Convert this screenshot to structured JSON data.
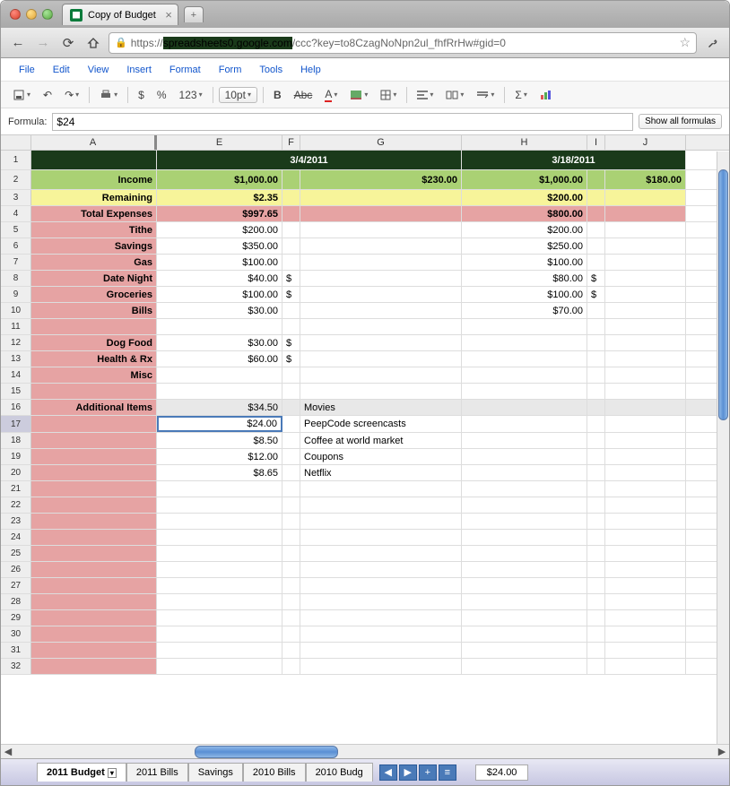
{
  "browser": {
    "tab_title": "Copy of Budget",
    "url_proto": "https",
    "url_host": "spreadsheets0.google.com",
    "url_rest": "/ccc?key=to8CzagNoNpn2ul_fhfRrHw#gid=0"
  },
  "menubar": [
    "File",
    "Edit",
    "View",
    "Insert",
    "Format",
    "Form",
    "Tools",
    "Help"
  ],
  "toolbar": {
    "currency": "$",
    "percent": "%",
    "more": "123",
    "font_size": "10pt"
  },
  "formula": {
    "label": "Formula:",
    "value": "$24",
    "show_all": "Show all formulas"
  },
  "columns": [
    "A",
    "E",
    "F",
    "G",
    "H",
    "I",
    "J"
  ],
  "header_row": {
    "date1": "3/4/2011",
    "date2": "3/18/2011"
  },
  "labels": {
    "income": "Income",
    "remaining": "Remaining",
    "total_expenses": "Total Expenses",
    "tithe": "Tithe",
    "savings": "Savings",
    "gas": "Gas",
    "date_night": "Date Night",
    "groceries": "Groceries",
    "bills": "Bills",
    "dog_food": "Dog Food",
    "health": "Health & Rx",
    "misc": "Misc",
    "additional": "Additional Items"
  },
  "period1": {
    "income1": "$1,000.00",
    "income2": "$230.00",
    "remaining": "$2.35",
    "total": "$997.65",
    "tithe": "$200.00",
    "savings": "$350.00",
    "gas": "$100.00",
    "date_night": "$40.00",
    "groceries": "$100.00",
    "bills": "$30.00",
    "dog_food": "$30.00",
    "health": "$60.00",
    "date_night_sym": "$",
    "groceries_sym": "$",
    "dog_food_sym": "$",
    "health_sym": "$"
  },
  "period2": {
    "income1": "$1,000.00",
    "income2": "$180.00",
    "remaining": "$200.00",
    "total": "$800.00",
    "tithe": "$200.00",
    "savings": "$250.00",
    "gas": "$100.00",
    "date_night": "$80.00",
    "groceries": "$100.00",
    "bills": "$70.00",
    "date_night_sym": "$",
    "groceries_sym": "$"
  },
  "additional": [
    {
      "amount": "$34.50",
      "desc": "Movies"
    },
    {
      "amount": "$24.00",
      "desc": "PeepCode screencasts"
    },
    {
      "amount": "$8.50",
      "desc": "Coffee at world market"
    },
    {
      "amount": "$12.00",
      "desc": "Coupons"
    },
    {
      "amount": "$8.65",
      "desc": "Netflix"
    }
  ],
  "sheets": [
    "2011 Budget",
    "2011 Bills",
    "Savings",
    "2010 Bills",
    "2010 Budg"
  ],
  "status_value": "$24.00"
}
